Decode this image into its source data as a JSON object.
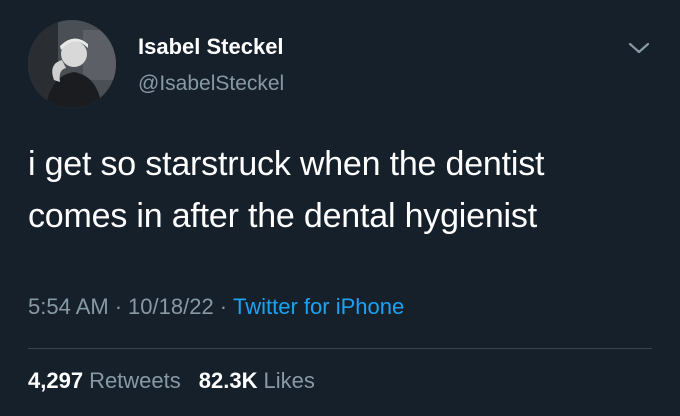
{
  "tweet": {
    "author": {
      "display_name": "Isabel Steckel",
      "handle": "@IsabelSteckel",
      "avatar_icon": "profile-photo"
    },
    "text_lines": [
      "i get so starstruck when the dentist",
      "comes in after the dental hygienist"
    ],
    "meta": {
      "time": "5:54 AM",
      "separator": "·",
      "date": "10/18/22",
      "source": "Twitter for iPhone"
    },
    "stats": {
      "retweets_count": "4,297",
      "retweets_label": "Retweets",
      "likes_count": "82.3K",
      "likes_label": "Likes"
    }
  },
  "colors": {
    "background": "#15202b",
    "primary_text": "#ffffff",
    "secondary_text": "#8899a6",
    "link": "#1da1f2",
    "divider": "#38444d"
  },
  "icons": {
    "menu": "chevron-down-icon"
  }
}
